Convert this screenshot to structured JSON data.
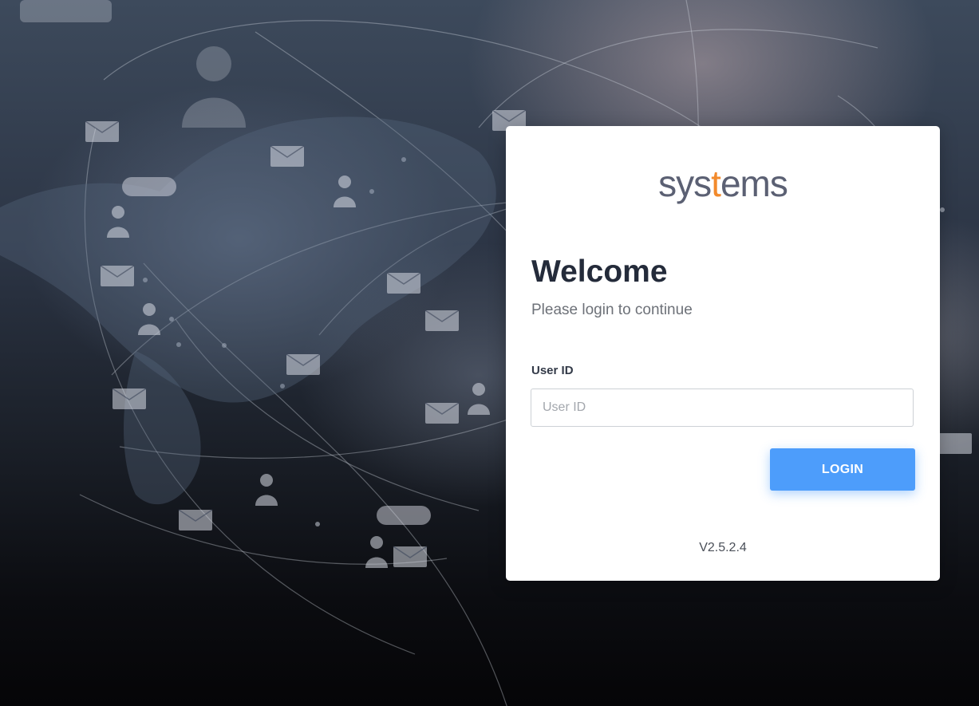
{
  "brand": {
    "logo_prefix": "sys",
    "logo_accent": "t",
    "logo_suffix": "ems",
    "logo_color": "#5b6073",
    "accent_color": "#f28a2c"
  },
  "login": {
    "title": "Welcome",
    "subtitle": "Please login to continue",
    "user_id_label": "User ID",
    "user_id_placeholder": "User ID",
    "user_id_value": "",
    "login_button_label": "LOGIN",
    "button_color": "#4d9dfb"
  },
  "footer": {
    "version": "V2.5.2.4"
  },
  "background": {
    "icons": [
      "mail-icon",
      "person-icon",
      "chat-bubble-icon",
      "network-lines",
      "world-map"
    ]
  }
}
